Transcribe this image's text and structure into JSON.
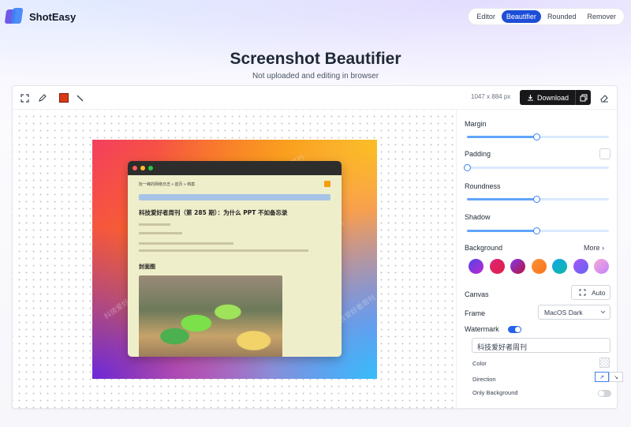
{
  "app": {
    "name": "ShotEasy"
  },
  "nav": {
    "items": [
      {
        "label": "Editor",
        "active": false
      },
      {
        "label": "Beautifier",
        "active": true
      },
      {
        "label": "Rounded",
        "active": false
      },
      {
        "label": "Remover",
        "active": false
      }
    ]
  },
  "hero": {
    "title": "Screenshot Beautifier",
    "subtitle": "Not uploaded and editing in browser"
  },
  "toolbar": {
    "dimensions": "1047 x 884 px",
    "download_label": "Download",
    "annotation_color": "#d93a14",
    "icons": [
      "crop-icon",
      "pencil-icon",
      "color-swatch",
      "line-icon",
      "download-icon",
      "copy-icon",
      "eraser-icon"
    ]
  },
  "preview": {
    "watermark_text": "科技爱好者周刊",
    "breadcrumb": "阮一峰的网络日志 » 首页 » 档案",
    "article_title": "科技爱好者周刊（第 285 期）：为什么 PPT 不如备忘录",
    "section_title": "封面图"
  },
  "panel": {
    "margin": {
      "label": "Margin",
      "value": 0.48
    },
    "padding": {
      "label": "Padding",
      "value": 0.0
    },
    "roundness": {
      "label": "Roundness",
      "value": 0.48
    },
    "shadow": {
      "label": "Shadow",
      "value": 0.48
    },
    "background": {
      "label": "Background",
      "more_label": "More",
      "swatches": [
        [
          "#4f46e5",
          "#c026d3"
        ],
        [
          "#db2777",
          "#e11d48"
        ],
        [
          "#7c3aed",
          "#be123c"
        ],
        [
          "#fb923c",
          "#f97316"
        ],
        [
          "#0ea5e9",
          "#14b8a6"
        ],
        [
          "#a855f7",
          "#6366f1"
        ],
        [
          "#f9a8d4",
          "#c084fc"
        ]
      ]
    },
    "canvas": {
      "label": "Canvas",
      "value": "Auto"
    },
    "frame": {
      "label": "Frame",
      "value": "MacOS Dark"
    },
    "watermark": {
      "label": "Watermark",
      "enabled": true,
      "text": "科技爱好者周刊",
      "color_label": "Color",
      "direction_label": "Direction",
      "directions": [
        "↗",
        "↘"
      ],
      "only_background_label": "Only Background",
      "only_background": false
    }
  }
}
